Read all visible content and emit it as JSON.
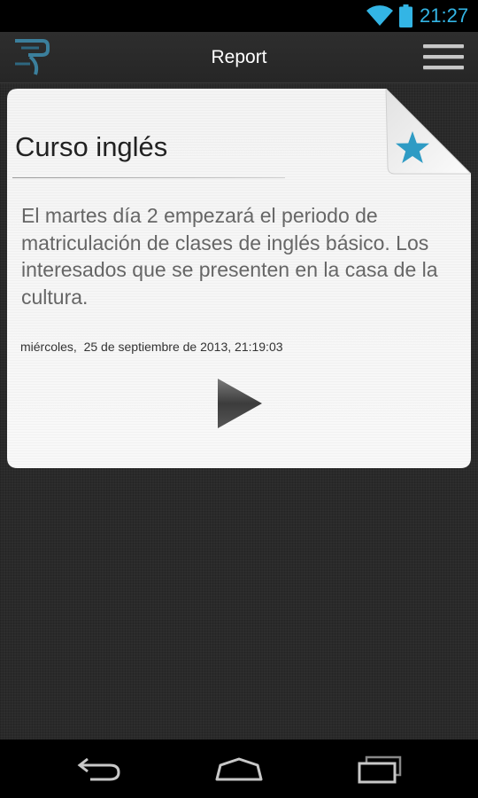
{
  "status_bar": {
    "time": "21:27",
    "icons": [
      "wifi-icon",
      "battery-icon"
    ],
    "accent_color": "#33b5e5"
  },
  "action_bar": {
    "title": "Report",
    "logo_icon": "app-logo-icon",
    "menu_icon": "menu-icon"
  },
  "card": {
    "title": "Curso inglés",
    "body": "El martes día 2 empezará el periodo de matriculación de clases de inglés básico. Los interesados que se presenten en la casa de la cultura.",
    "date": "miércoles,  25 de septiembre de 2013, 21:19:03",
    "star_icon": "star-icon",
    "star_color": "#2e9bc4",
    "play_icon": "play-icon"
  },
  "nav_bar": {
    "icons": [
      "back-icon",
      "home-icon",
      "recent-apps-icon"
    ]
  }
}
